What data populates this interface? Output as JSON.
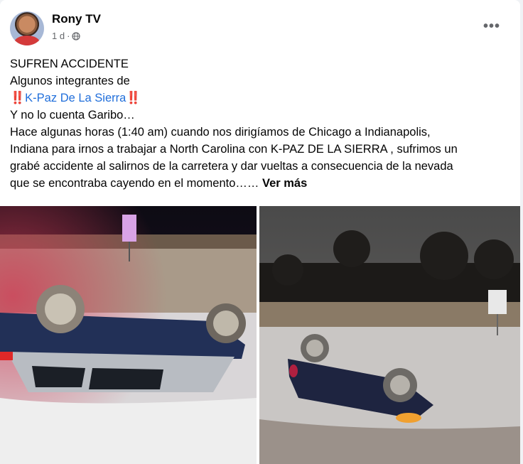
{
  "post": {
    "author": "Rony TV",
    "time": "1 d",
    "separator": "·",
    "more_label": "•••",
    "lines": {
      "l1": "SUFREN ACCIDENTE",
      "l2": "Algunos integrantes de",
      "l3_mention": "K-Paz De La Sierra",
      "l3_bang_left": "‼️",
      "l3_bang_right": "‼️",
      "l4": "Y no lo cuenta Garibo…",
      "l5": "Hace algunas horas (1:40 am) cuando nos dirigíamos de Chicago a Indianapolis,",
      "l6": "Indiana para irnos a trabajar a North Carolina con K-PAZ DE LA SIERRA , sufrimos un",
      "l7": "grabé accidente al salirnos de la carretera y dar vueltas a consecuencia de la nevada",
      "l8": "que se encontraba cayendo en el momento……",
      "see_more": "Ver más"
    }
  },
  "icons": {
    "globe": "globe-icon",
    "more": "more-options-icon"
  },
  "colors": {
    "mention": "#216fdb",
    "secondary_text": "#65676b",
    "background": "#f0f2f5"
  }
}
